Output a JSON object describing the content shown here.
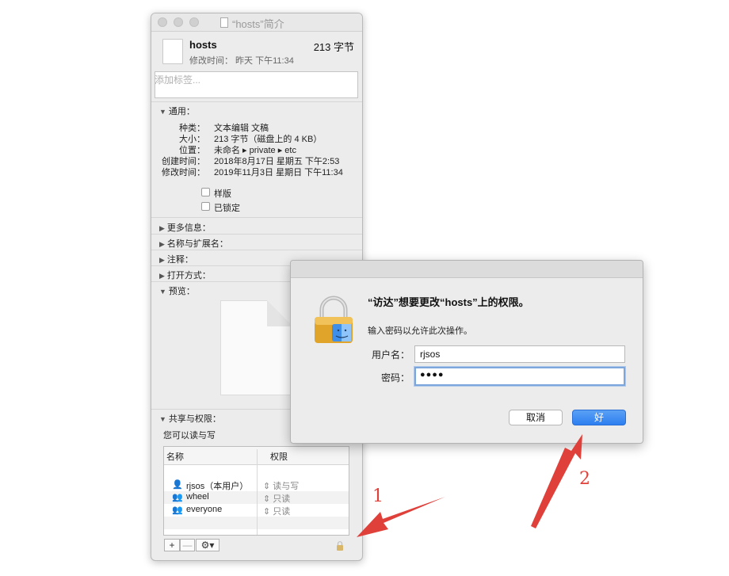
{
  "info_window": {
    "title": "“hosts”简介",
    "file_name": "hosts",
    "file_size": "213 字节",
    "modified_line": "修改时间： 昨天 下午11:34",
    "tags_placeholder": "添加标签...",
    "general": {
      "header": "通用：",
      "rows": [
        {
          "label": "种类：",
          "value": "文本编辑 文稿"
        },
        {
          "label": "大小：",
          "value": "213 字节（磁盘上的 4 KB）"
        },
        {
          "label": "位置：",
          "value": "未命名 ▸ private ▸ etc"
        },
        {
          "label": "创建时间：",
          "value": "2018年8月17日 星期五 下午2:53"
        },
        {
          "label": "修改时间：",
          "value": "2019年11月3日 星期日 下午11:34"
        }
      ],
      "checkbox_stationery": "样版",
      "checkbox_locked": "已锁定"
    },
    "sections": [
      "更多信息：",
      "名称与扩展名：",
      "注释：",
      "打开方式："
    ],
    "preview_header": "预览：",
    "sharing": {
      "header": "共享与权限：",
      "summary": "您可以读与写",
      "col_name": "名称",
      "col_privilege": "权限",
      "rows": [
        {
          "name": "rjsos（本用户）",
          "privilege": "读与写"
        },
        {
          "name": "wheel",
          "privilege": "只读"
        },
        {
          "name": "everyone",
          "privilege": "只读"
        }
      ]
    },
    "toolbar": {
      "add": "+",
      "remove": "—",
      "action": "⚙▾"
    }
  },
  "auth_dialog": {
    "title": "“访达”想要更改“hosts”上的权限。",
    "subtitle": "输入密码以允许此次操作。",
    "username_label": "用户名：",
    "username_value": "rjsos",
    "password_label": "密码：",
    "password_value": "●●●●",
    "cancel_label": "取消",
    "ok_label": "好"
  },
  "annotations": {
    "label_1": "1",
    "label_2": "2",
    "color": "#e0403a"
  }
}
